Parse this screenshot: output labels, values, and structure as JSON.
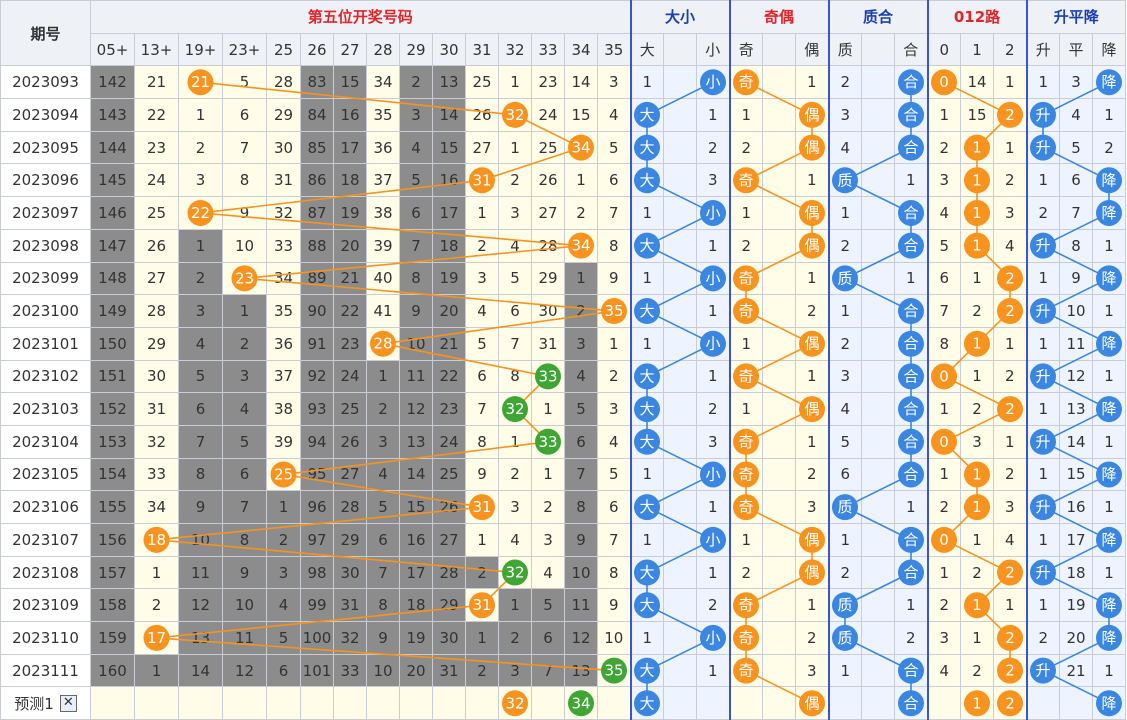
{
  "header": {
    "period_label": "期号",
    "group_number": "第五位开奖号码",
    "group_size": "大小",
    "group_parity": "奇偶",
    "group_prime": "质合",
    "group_mod": "012路",
    "group_trend": "升平降",
    "number_cols": [
      "05+",
      "13+",
      "19+",
      "23+",
      "25",
      "26",
      "27",
      "28",
      "29",
      "30",
      "31",
      "32",
      "33",
      "34",
      "35"
    ],
    "size_cols": [
      "大",
      "",
      "小"
    ],
    "parity_cols": [
      "奇",
      "",
      "偶"
    ],
    "prime_cols": [
      "质",
      "",
      "合"
    ],
    "mod_cols": [
      "0",
      "1",
      "2"
    ],
    "trend_cols": [
      "升",
      "平",
      "降"
    ]
  },
  "rows": [
    {
      "period": "2023093",
      "nums": [
        "142",
        "21",
        "21",
        "5",
        "28",
        "83",
        "15",
        "34",
        "2",
        "13",
        "25",
        "1",
        "23",
        "14",
        "3"
      ],
      "size": [
        "1",
        "",
        "小"
      ],
      "parity": [
        "奇",
        "",
        "1"
      ],
      "prime": [
        "2",
        "",
        "合"
      ],
      "mod": [
        "0",
        "14",
        "1"
      ],
      "trend": [
        "1",
        "3",
        "降"
      ]
    },
    {
      "period": "2023094",
      "nums": [
        "143",
        "22",
        "1",
        "6",
        "29",
        "84",
        "16",
        "35",
        "3",
        "14",
        "26",
        "32",
        "24",
        "15",
        "4"
      ],
      "size": [
        "大",
        "",
        "1"
      ],
      "parity": [
        "1",
        "",
        "偶"
      ],
      "prime": [
        "3",
        "",
        "合"
      ],
      "mod": [
        "1",
        "15",
        "2"
      ],
      "trend": [
        "升",
        "4",
        "1"
      ]
    },
    {
      "period": "2023095",
      "nums": [
        "144",
        "23",
        "2",
        "7",
        "30",
        "85",
        "17",
        "36",
        "4",
        "15",
        "27",
        "1",
        "25",
        "34",
        "5"
      ],
      "size": [
        "大",
        "",
        "2"
      ],
      "parity": [
        "2",
        "",
        "偶"
      ],
      "prime": [
        "4",
        "",
        "合"
      ],
      "mod": [
        "2",
        "1",
        "1"
      ],
      "trend": [
        "升",
        "5",
        "2"
      ]
    },
    {
      "period": "2023096",
      "nums": [
        "145",
        "24",
        "3",
        "8",
        "31",
        "86",
        "18",
        "37",
        "5",
        "16",
        "31",
        "2",
        "26",
        "1",
        "6"
      ],
      "size": [
        "大",
        "",
        "3"
      ],
      "parity": [
        "奇",
        "",
        "1"
      ],
      "prime": [
        "质",
        "",
        "1"
      ],
      "mod": [
        "3",
        "1",
        "2"
      ],
      "trend": [
        "1",
        "6",
        "降"
      ]
    },
    {
      "period": "2023097",
      "nums": [
        "146",
        "25",
        "22",
        "9",
        "32",
        "87",
        "19",
        "38",
        "6",
        "17",
        "1",
        "3",
        "27",
        "2",
        "7"
      ],
      "size": [
        "1",
        "",
        "小"
      ],
      "parity": [
        "1",
        "",
        "偶"
      ],
      "prime": [
        "1",
        "",
        "合"
      ],
      "mod": [
        "4",
        "1",
        "3"
      ],
      "trend": [
        "2",
        "7",
        "降"
      ]
    },
    {
      "period": "2023098",
      "nums": [
        "147",
        "26",
        "1",
        "10",
        "33",
        "88",
        "20",
        "39",
        "7",
        "18",
        "2",
        "4",
        "28",
        "34",
        "8"
      ],
      "size": [
        "大",
        "",
        "1"
      ],
      "parity": [
        "2",
        "",
        "偶"
      ],
      "prime": [
        "2",
        "",
        "合"
      ],
      "mod": [
        "5",
        "1",
        "4"
      ],
      "trend": [
        "升",
        "8",
        "1"
      ]
    },
    {
      "period": "2023099",
      "nums": [
        "148",
        "27",
        "2",
        "23",
        "34",
        "89",
        "21",
        "40",
        "8",
        "19",
        "3",
        "5",
        "29",
        "1",
        "9"
      ],
      "size": [
        "1",
        "",
        "小"
      ],
      "parity": [
        "奇",
        "",
        "1"
      ],
      "prime": [
        "质",
        "",
        "1"
      ],
      "mod": [
        "6",
        "1",
        "2"
      ],
      "trend": [
        "1",
        "9",
        "降"
      ]
    },
    {
      "period": "2023100",
      "nums": [
        "149",
        "28",
        "3",
        "1",
        "35",
        "90",
        "22",
        "41",
        "9",
        "20",
        "4",
        "6",
        "30",
        "2",
        "35"
      ],
      "size": [
        "大",
        "",
        "1"
      ],
      "parity": [
        "奇",
        "",
        "2"
      ],
      "prime": [
        "1",
        "",
        "合"
      ],
      "mod": [
        "7",
        "2",
        "2"
      ],
      "trend": [
        "升",
        "10",
        "1"
      ]
    },
    {
      "period": "2023101",
      "nums": [
        "150",
        "29",
        "4",
        "2",
        "36",
        "91",
        "23",
        "28",
        "10",
        "21",
        "5",
        "7",
        "31",
        "3",
        "1"
      ],
      "size": [
        "1",
        "",
        "小"
      ],
      "parity": [
        "1",
        "",
        "偶"
      ],
      "prime": [
        "2",
        "",
        "合"
      ],
      "mod": [
        "8",
        "1",
        "1"
      ],
      "trend": [
        "1",
        "11",
        "降"
      ]
    },
    {
      "period": "2023102",
      "nums": [
        "151",
        "30",
        "5",
        "3",
        "37",
        "92",
        "24",
        "1",
        "11",
        "22",
        "6",
        "8",
        "33",
        "4",
        "2"
      ],
      "size": [
        "大",
        "",
        "1"
      ],
      "parity": [
        "奇",
        "",
        "1"
      ],
      "prime": [
        "3",
        "",
        "合"
      ],
      "mod": [
        "0",
        "1",
        "2"
      ],
      "trend": [
        "升",
        "12",
        "1"
      ]
    },
    {
      "period": "2023103",
      "nums": [
        "152",
        "31",
        "6",
        "4",
        "38",
        "93",
        "25",
        "2",
        "12",
        "23",
        "7",
        "32",
        "1",
        "5",
        "3"
      ],
      "size": [
        "大",
        "",
        "2"
      ],
      "parity": [
        "1",
        "",
        "偶"
      ],
      "prime": [
        "4",
        "",
        "合"
      ],
      "mod": [
        "1",
        "2",
        "2"
      ],
      "trend": [
        "1",
        "13",
        "降"
      ]
    },
    {
      "period": "2023104",
      "nums": [
        "153",
        "32",
        "7",
        "5",
        "39",
        "94",
        "26",
        "3",
        "13",
        "24",
        "8",
        "1",
        "33",
        "6",
        "4"
      ],
      "size": [
        "大",
        "",
        "3"
      ],
      "parity": [
        "奇",
        "",
        "1"
      ],
      "prime": [
        "5",
        "",
        "合"
      ],
      "mod": [
        "0",
        "3",
        "1"
      ],
      "trend": [
        "升",
        "14",
        "1"
      ]
    },
    {
      "period": "2023105",
      "nums": [
        "154",
        "33",
        "8",
        "6",
        "25",
        "95",
        "27",
        "4",
        "14",
        "25",
        "9",
        "2",
        "1",
        "7",
        "5"
      ],
      "size": [
        "1",
        "",
        "小"
      ],
      "parity": [
        "奇",
        "",
        "2"
      ],
      "prime": [
        "6",
        "",
        "合"
      ],
      "mod": [
        "1",
        "1",
        "2"
      ],
      "trend": [
        "1",
        "15",
        "降"
      ]
    },
    {
      "period": "2023106",
      "nums": [
        "155",
        "34",
        "9",
        "7",
        "1",
        "96",
        "28",
        "5",
        "15",
        "26",
        "31",
        "3",
        "2",
        "8",
        "6"
      ],
      "size": [
        "大",
        "",
        "1"
      ],
      "parity": [
        "奇",
        "",
        "3"
      ],
      "prime": [
        "质",
        "",
        "1"
      ],
      "mod": [
        "2",
        "1",
        "3"
      ],
      "trend": [
        "升",
        "16",
        "1"
      ]
    },
    {
      "period": "2023107",
      "nums": [
        "156",
        "18",
        "10",
        "8",
        "2",
        "97",
        "29",
        "6",
        "16",
        "27",
        "1",
        "4",
        "3",
        "9",
        "7"
      ],
      "size": [
        "1",
        "",
        "小"
      ],
      "parity": [
        "1",
        "",
        "偶"
      ],
      "prime": [
        "1",
        "",
        "合"
      ],
      "mod": [
        "0",
        "1",
        "4"
      ],
      "trend": [
        "1",
        "17",
        "降"
      ]
    },
    {
      "period": "2023108",
      "nums": [
        "157",
        "1",
        "11",
        "9",
        "3",
        "98",
        "30",
        "7",
        "17",
        "28",
        "2",
        "32",
        "4",
        "10",
        "8"
      ],
      "size": [
        "大",
        "",
        "1"
      ],
      "parity": [
        "2",
        "",
        "偶"
      ],
      "prime": [
        "2",
        "",
        "合"
      ],
      "mod": [
        "1",
        "2",
        "2"
      ],
      "trend": [
        "升",
        "18",
        "1"
      ]
    },
    {
      "period": "2023109",
      "nums": [
        "158",
        "2",
        "12",
        "10",
        "4",
        "99",
        "31",
        "8",
        "18",
        "29",
        "31",
        "1",
        "5",
        "11",
        "9"
      ],
      "size": [
        "大",
        "",
        "2"
      ],
      "parity": [
        "奇",
        "",
        "1"
      ],
      "prime": [
        "质",
        "",
        "1"
      ],
      "mod": [
        "2",
        "1",
        "1"
      ],
      "trend": [
        "1",
        "19",
        "降"
      ]
    },
    {
      "period": "2023110",
      "nums": [
        "159",
        "17",
        "13",
        "11",
        "5",
        "100",
        "32",
        "9",
        "19",
        "30",
        "1",
        "2",
        "6",
        "12",
        "10"
      ],
      "size": [
        "1",
        "",
        "小"
      ],
      "parity": [
        "奇",
        "",
        "2"
      ],
      "prime": [
        "质",
        "",
        "2"
      ],
      "mod": [
        "3",
        "1",
        "2"
      ],
      "trend": [
        "2",
        "20",
        "降"
      ]
    },
    {
      "period": "2023111",
      "nums": [
        "160",
        "1",
        "14",
        "12",
        "6",
        "101",
        "33",
        "10",
        "20",
        "31",
        "2",
        "3",
        "7",
        "13",
        "35"
      ],
      "size": [
        "大",
        "",
        "1"
      ],
      "parity": [
        "奇",
        "",
        "3"
      ],
      "prime": [
        "1",
        "",
        "合"
      ],
      "mod": [
        "4",
        "2",
        "2"
      ],
      "trend": [
        "升",
        "21",
        "1"
      ]
    }
  ],
  "prediction": {
    "label": "预测1",
    "close_label": "✕",
    "balls": [
      "32",
      "34"
    ],
    "size": "大",
    "parity": "偶",
    "prime": "合",
    "mod": [
      "1",
      "2"
    ],
    "trend": "降"
  },
  "chart_data": {
    "type": "table",
    "title": "第五位开奖号码",
    "hit_positions": [
      {
        "period": "2023093",
        "col": 2,
        "value": "21"
      },
      {
        "period": "2023094",
        "col": 11,
        "value": "32"
      },
      {
        "period": "2023095",
        "col": 13,
        "value": "34"
      },
      {
        "period": "2023096",
        "col": 10,
        "value": "31"
      },
      {
        "period": "2023097",
        "col": 2,
        "value": "22"
      },
      {
        "period": "2023098",
        "col": 13,
        "value": "34"
      },
      {
        "period": "2023099",
        "col": 3,
        "value": "23"
      },
      {
        "period": "2023100",
        "col": 14,
        "value": "35"
      },
      {
        "period": "2023101",
        "col": 7,
        "value": "28"
      },
      {
        "period": "2023102",
        "col": 12,
        "value": "33"
      },
      {
        "period": "2023103",
        "col": 11,
        "value": "32"
      },
      {
        "period": "2023104",
        "col": 12,
        "value": "33"
      },
      {
        "period": "2023105",
        "col": 4,
        "value": "25"
      },
      {
        "period": "2023106",
        "col": 10,
        "value": "31"
      },
      {
        "period": "2023107",
        "col": 1,
        "value": "18"
      },
      {
        "period": "2023108",
        "col": 11,
        "value": "32"
      },
      {
        "period": "2023109",
        "col": 10,
        "value": "31"
      },
      {
        "period": "2023110",
        "col": 1,
        "value": "17"
      },
      {
        "period": "2023111",
        "col": 14,
        "value": "35"
      }
    ],
    "colors": {
      "orange": "#f7931e",
      "green": "#3fa535",
      "blue": "#3a86e0",
      "gray": "#8c8c8c",
      "line_orange": "#f7931e",
      "line_blue": "#3a86e0"
    }
  }
}
